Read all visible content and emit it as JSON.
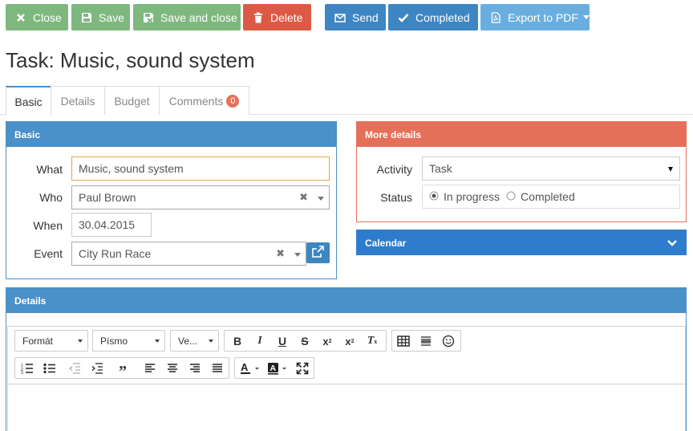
{
  "toolbar": {
    "close": "Close",
    "save": "Save",
    "save_close": "Save and close",
    "delete": "Delete",
    "send": "Send",
    "completed": "Completed",
    "export_pdf": "Export to PDF"
  },
  "page_title": "Task: Music, sound system",
  "tabs": {
    "basic": "Basic",
    "details": "Details",
    "budget": "Budget",
    "comments": "Comments",
    "comments_count": "0"
  },
  "basic_panel": {
    "title": "Basic",
    "what_label": "What",
    "what_value": "Music, sound system",
    "who_label": "Who",
    "who_value": "Paul Brown",
    "when_label": "When",
    "when_value": "30.04.2015",
    "event_label": "Event",
    "event_value": "City Run Race"
  },
  "more_panel": {
    "title": "More details",
    "activity_label": "Activity",
    "activity_value": "Task",
    "status_label": "Status",
    "status_options": [
      "In progress",
      "Completed"
    ],
    "status_selected": "In progress"
  },
  "calendar_panel": {
    "title": "Calendar"
  },
  "details_panel": {
    "title": "Details"
  },
  "editor": {
    "format_label": "Formát",
    "font_label": "Písmo",
    "size_label": "Ve..."
  },
  "colors": {
    "green": "#7fb87f",
    "red": "#dc5a45",
    "blue": "#3e86c2",
    "light_blue": "#6aaee0",
    "panel_blue": "#4a90c9",
    "panel_orange": "#e5705a",
    "calendar_blue": "#2e7ccd"
  }
}
